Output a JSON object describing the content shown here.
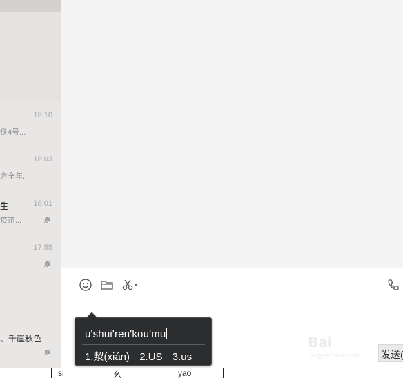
{
  "chat_list": {
    "items": [
      {
        "time": "18:10",
        "name": "",
        "preview": "佚4号...",
        "muted": false
      },
      {
        "time": "18:03",
        "name": "",
        "preview": "方全年...",
        "muted": false
      },
      {
        "time": "18:01",
        "name": "生",
        "preview": "疫苗...",
        "muted": true
      },
      {
        "time": "17:55",
        "name": "",
        "preview": "",
        "muted": true
      },
      {
        "time": "",
        "name": "、千崖秋色",
        "preview": "",
        "muted": true
      }
    ]
  },
  "input_toolbar": {
    "icons": [
      "emoji-icon",
      "folder-icon",
      "scissors-icon",
      "phone-icon"
    ]
  },
  "send_button": {
    "label": "发送("
  },
  "watermark": {
    "text": "Bai",
    "subtext": "jingyan.baidu.com"
  },
  "ime": {
    "pinyin": "u'shui'ren'kou'mu",
    "candidates": [
      "1.洯(xián)",
      "2.US",
      "3.us"
    ]
  },
  "bottom_strip": {
    "cells": [
      "si",
      "幺",
      "yao"
    ]
  },
  "colors": {
    "chat_bg": "#f4f4f4",
    "sidebar_bg": "#e9e7e6",
    "ime_bg": "#2b2d2f"
  }
}
